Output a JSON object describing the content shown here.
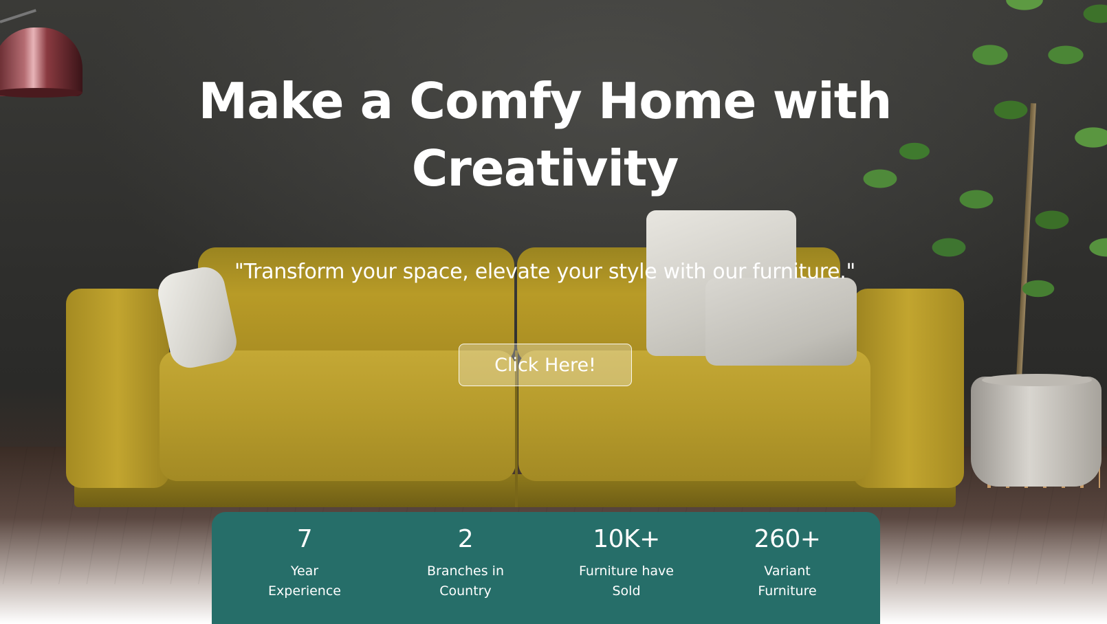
{
  "hero": {
    "headline": "Make a Comfy Home with Creativity",
    "tagline": "\"Transform your space, elevate your style with our furniture.\"",
    "cta_label": "Click Here!"
  },
  "stats": [
    {
      "value": "7",
      "label": "Year Experience"
    },
    {
      "value": "2",
      "label": "Branches in Country"
    },
    {
      "value": "10K+",
      "label": "Furniture have Sold"
    },
    {
      "value": "260+",
      "label": "Variant Furniture"
    }
  ],
  "colors": {
    "stats_background": "#266e69",
    "text": "#ffffff",
    "sofa": "#b89b27"
  }
}
